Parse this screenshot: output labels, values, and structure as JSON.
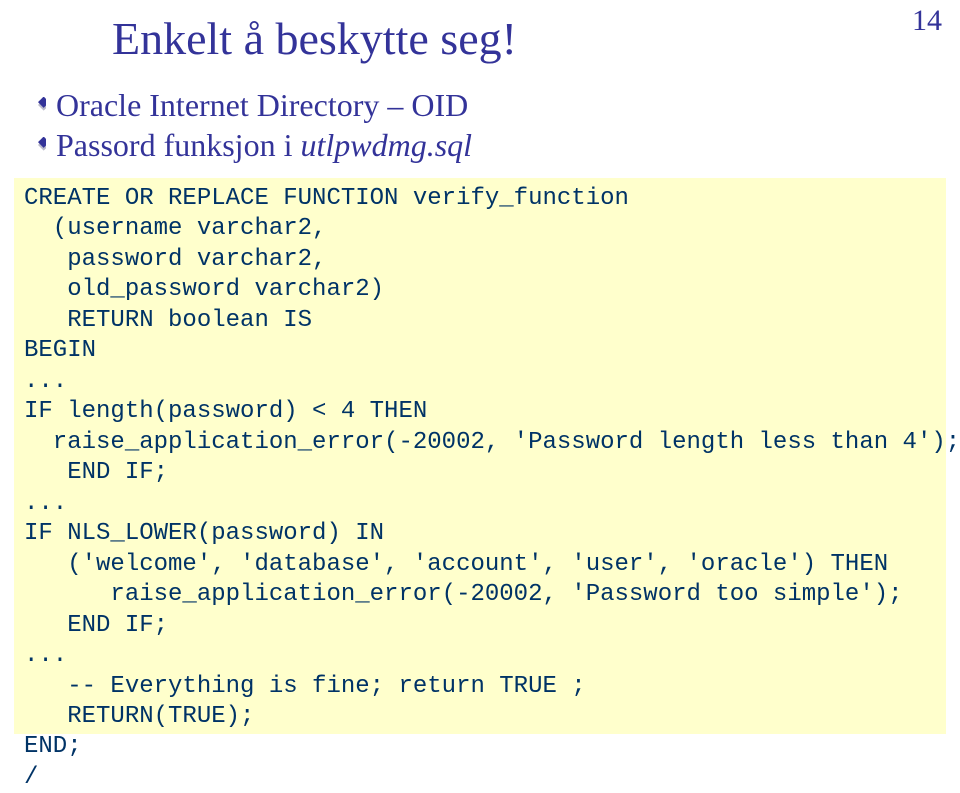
{
  "page_number": "14",
  "title": "Enkelt å beskytte seg!",
  "bullets": {
    "line1": "Oracle Internet Directory – OID",
    "line2_prefix": "Passord funksjon i ",
    "line2_italic": "utlpwdmg.sql"
  },
  "code": {
    "l1": "CREATE OR REPLACE FUNCTION verify_function",
    "l2": "  (username varchar2,",
    "l3": "   password varchar2,",
    "l4": "   old_password varchar2)",
    "l5": "   RETURN boolean IS",
    "l6": "BEGIN",
    "l7": "...",
    "l8": "IF length(password) < 4 THEN",
    "l9": "  raise_application_error(-20002, 'Password length less than 4');",
    "l10": "   END IF;",
    "l11": "...",
    "l12": "IF NLS_LOWER(password) IN",
    "l13": "   ('welcome', 'database', 'account', 'user', 'oracle') THEN",
    "l14": "      raise_application_error(-20002, 'Password too simple');",
    "l15": "   END IF;",
    "l16": "...",
    "l17": "   -- Everything is fine; return TRUE ;",
    "l18": "   RETURN(TRUE);",
    "l19": "END;",
    "l20": "/"
  }
}
